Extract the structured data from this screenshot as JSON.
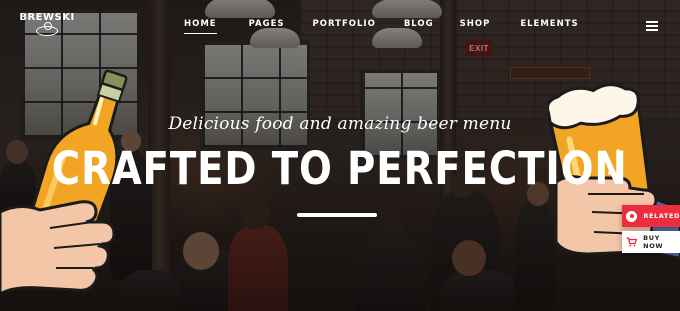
{
  "brand": {
    "name": "BREWSKI"
  },
  "nav": {
    "items": [
      {
        "label": "HOME",
        "active": true
      },
      {
        "label": "PAGES"
      },
      {
        "label": "PORTFOLIO"
      },
      {
        "label": "BLOG"
      },
      {
        "label": "SHOP"
      },
      {
        "label": "ELEMENTS"
      }
    ],
    "menu_icon": "hamburger-icon"
  },
  "hero": {
    "subtitle": "Delicious food and amazing beer menu",
    "title": "CRAFTED TO PERFECTION"
  },
  "background": {
    "exit_sign": "EXIT"
  },
  "side_buttons": {
    "related": {
      "label": "RELATED",
      "icon": "target-icon",
      "color": "#ec2d3f"
    },
    "buy": {
      "label": "BUY NOW",
      "icon": "cart-icon"
    }
  },
  "colors": {
    "accent": "#ec2d3f",
    "text": "#ffffff",
    "beer": "#f2a524"
  }
}
